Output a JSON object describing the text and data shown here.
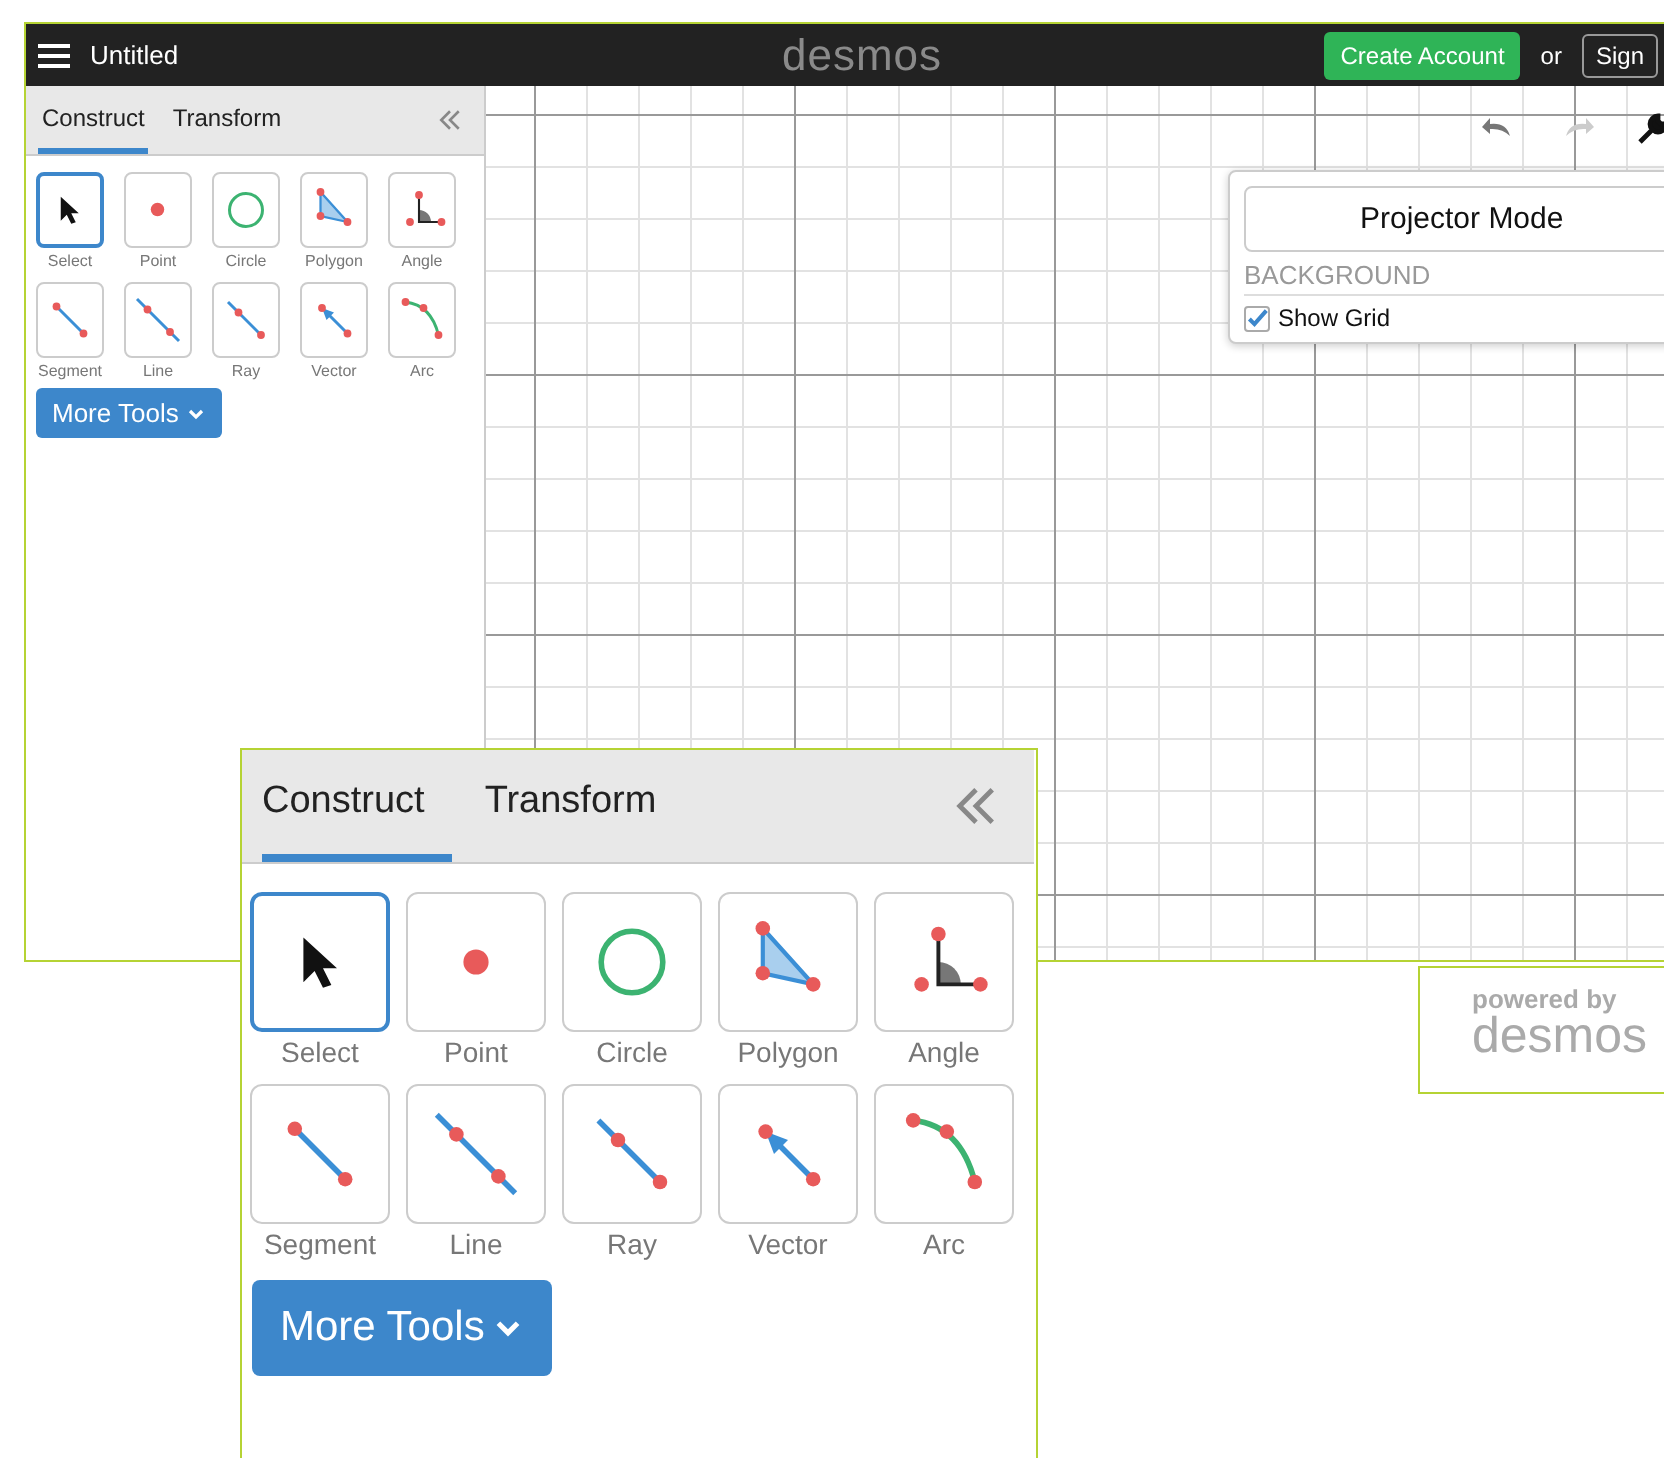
{
  "app_window": {
    "top_bar": {
      "title": "Untitled",
      "logo": "desmos",
      "create_account": "Create Account",
      "or": "or",
      "sign_in": "Sign"
    },
    "tool_panel": {
      "tabs": [
        {
          "label": "Construct",
          "selected": true
        },
        {
          "label": "Transform",
          "selected": false
        }
      ],
      "tools": [
        {
          "kind": "select",
          "label": "Select",
          "selected": true
        },
        {
          "kind": "point",
          "label": "Point",
          "selected": false
        },
        {
          "kind": "circle",
          "label": "Circle",
          "selected": false
        },
        {
          "kind": "polygon",
          "label": "Polygon",
          "selected": false
        },
        {
          "kind": "angle",
          "label": "Angle",
          "selected": false
        },
        {
          "kind": "segment",
          "label": "Segment",
          "selected": false
        },
        {
          "kind": "line",
          "label": "Line",
          "selected": false
        },
        {
          "kind": "ray",
          "label": "Ray",
          "selected": false
        },
        {
          "kind": "vector",
          "label": "Vector",
          "selected": false
        },
        {
          "kind": "arc",
          "label": "Arc",
          "selected": false
        }
      ],
      "more_tools": "More Tools"
    },
    "settings_popup": {
      "projector_mode": "Projector Mode",
      "heading": "BACKGROUND",
      "show_grid": {
        "label": "Show Grid",
        "checked": true
      }
    }
  },
  "zoomed_panel": {
    "tabs": [
      {
        "label": "Construct",
        "selected": true
      },
      {
        "label": "Transform",
        "selected": false
      }
    ],
    "tools": [
      {
        "kind": "select",
        "label": "Select",
        "selected": true
      },
      {
        "kind": "point",
        "label": "Point",
        "selected": false
      },
      {
        "kind": "circle",
        "label": "Circle",
        "selected": false
      },
      {
        "kind": "polygon",
        "label": "Polygon",
        "selected": false
      },
      {
        "kind": "angle",
        "label": "Angle",
        "selected": false
      },
      {
        "kind": "segment",
        "label": "Segment",
        "selected": false
      },
      {
        "kind": "line",
        "label": "Line",
        "selected": false
      },
      {
        "kind": "ray",
        "label": "Ray",
        "selected": false
      },
      {
        "kind": "vector",
        "label": "Vector",
        "selected": false
      },
      {
        "kind": "arc",
        "label": "Arc",
        "selected": false
      }
    ],
    "more_tools": "More Tools"
  },
  "powered_by": {
    "caption": "powered by",
    "logo": "desmos"
  }
}
